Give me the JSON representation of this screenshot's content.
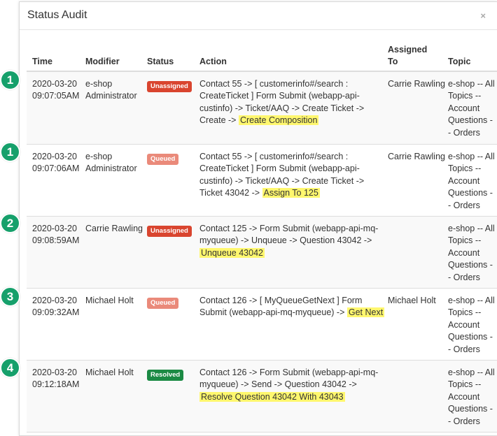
{
  "modal": {
    "title": "Status Audit",
    "close_glyph": "×"
  },
  "columns": {
    "time": "Time",
    "modifier": "Modifier",
    "status": "Status",
    "action": "Action",
    "assigned_line1": "Assigned",
    "assigned_line2": "To",
    "topic": "Topic"
  },
  "status_colors": {
    "Unassigned": "#d9452f",
    "Queued": "#ea8a7a",
    "Resolved": "#1b8a44"
  },
  "highlight_color": "#fff76e",
  "step_color": "#16a06b",
  "rows": [
    {
      "step": "1",
      "date": "2020-03-20",
      "time": "09:07:05AM",
      "modifier": "e-shop Administrator",
      "status": "Unassigned",
      "action_text": "Contact 55 -> [ customerinfo#/search : CreateTicket ] Form Submit (webapp-api-custinfo) -> Ticket/AAQ -> Create Ticket -> Create ->",
      "action_highlight": "Create Composition",
      "assigned": "Carrie Rawling",
      "topic": "e-shop -- All Topics -- Account Questions -- Orders"
    },
    {
      "step": "1",
      "date": "2020-03-20",
      "time": "09:07:06AM",
      "modifier": "e-shop Administrator",
      "status": "Queued",
      "action_text": "Contact 55 -> [ customerinfo#/search : CreateTicket ] Form Submit (webapp-api-custinfo) -> Ticket/AAQ -> Create Ticket -> Ticket 43042 ->",
      "action_highlight": "Assign To 125",
      "assigned": "Carrie Rawling",
      "topic": "e-shop -- All Topics -- Account Questions -- Orders"
    },
    {
      "step": "2",
      "date": "2020-03-20",
      "time": "09:08:59AM",
      "modifier": "Carrie Rawling",
      "status": "Unassigned",
      "action_text": "Contact 125 -> Form Submit (webapp-api-mq-myqueue) -> Unqueue -> Question 43042 ->",
      "action_highlight": "Unqueue 43042",
      "assigned": "",
      "topic": "e-shop -- All Topics -- Account Questions -- Orders"
    },
    {
      "step": "3",
      "date": "2020-03-20",
      "time": "09:09:32AM",
      "modifier": "Michael Holt",
      "status": "Queued",
      "action_text": "Contact 126 -> [ MyQueueGetNext ] Form Submit (webapp-api-mq-myqueue) ->",
      "action_highlight": "Get Next",
      "assigned": "Michael Holt",
      "topic": "e-shop -- All Topics -- Account Questions -- Orders"
    },
    {
      "step": "4",
      "date": "2020-03-20",
      "time": "09:12:18AM",
      "modifier": "Michael Holt",
      "status": "Resolved",
      "action_text": "Contact 126 -> Form Submit (webapp-api-mq-myqueue) -> Send -> Question 43042 ->",
      "action_highlight": "Resolve Question 43042 With 43043",
      "assigned": "",
      "topic": "e-shop -- All Topics -- Account Questions -- Orders"
    }
  ]
}
